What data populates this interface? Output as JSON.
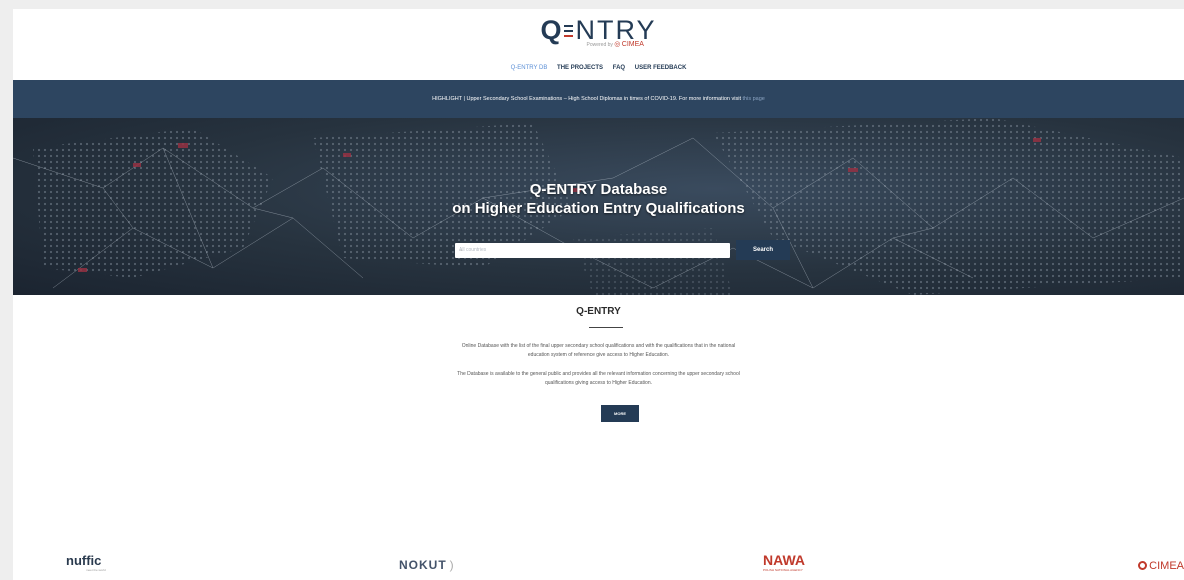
{
  "header": {
    "logo_q": "Q",
    "logo_rest": "NTRY",
    "powered_by": "Powered by",
    "powered_brand": "CIMEA"
  },
  "nav": {
    "items": [
      {
        "label": "Q-ENTRY DB",
        "active": true
      },
      {
        "label": "THE PROJECTS",
        "active": false
      },
      {
        "label": "FAQ",
        "active": false
      },
      {
        "label": "USER FEEDBACK",
        "active": false
      }
    ]
  },
  "highlight": {
    "text": "HIGHLIGHT | Upper Secondary School Examinations – High School Diplomas in times of COVID-19. For more information visit ",
    "link": "this page"
  },
  "hero": {
    "title_line1": "Q-ENTRY Database",
    "title_line2": "on Higher Education Entry Qualifications",
    "search_placeholder": "All countries",
    "search_button": "Search"
  },
  "main": {
    "title": "Q-ENTRY",
    "paragraph1_line1": "Online Database with the list of the final upper secondary school qualifications and with the qualifications that in the national",
    "paragraph1_line2": "education system of reference give access to Higher Education.",
    "paragraph2_line1": "The Database is available to the general public and provides all the relevant information concerning the upper secondary school",
    "paragraph2_line2": "qualifications giving access to Higher Education.",
    "more_button": "MORE"
  },
  "footer_logos": {
    "nuffic": "nuffic",
    "nuffic_tag": "meet the world",
    "nokut": "NOKUT",
    "nawa": "NAWA",
    "nawa_tag": "POLISH NATIONAL AGENCY",
    "cimea": "CIMEA"
  },
  "colors": {
    "navy": "#243b55",
    "bar": "#2d4560",
    "accent_red": "#c0392b",
    "nav_active": "#5b8fd6"
  }
}
